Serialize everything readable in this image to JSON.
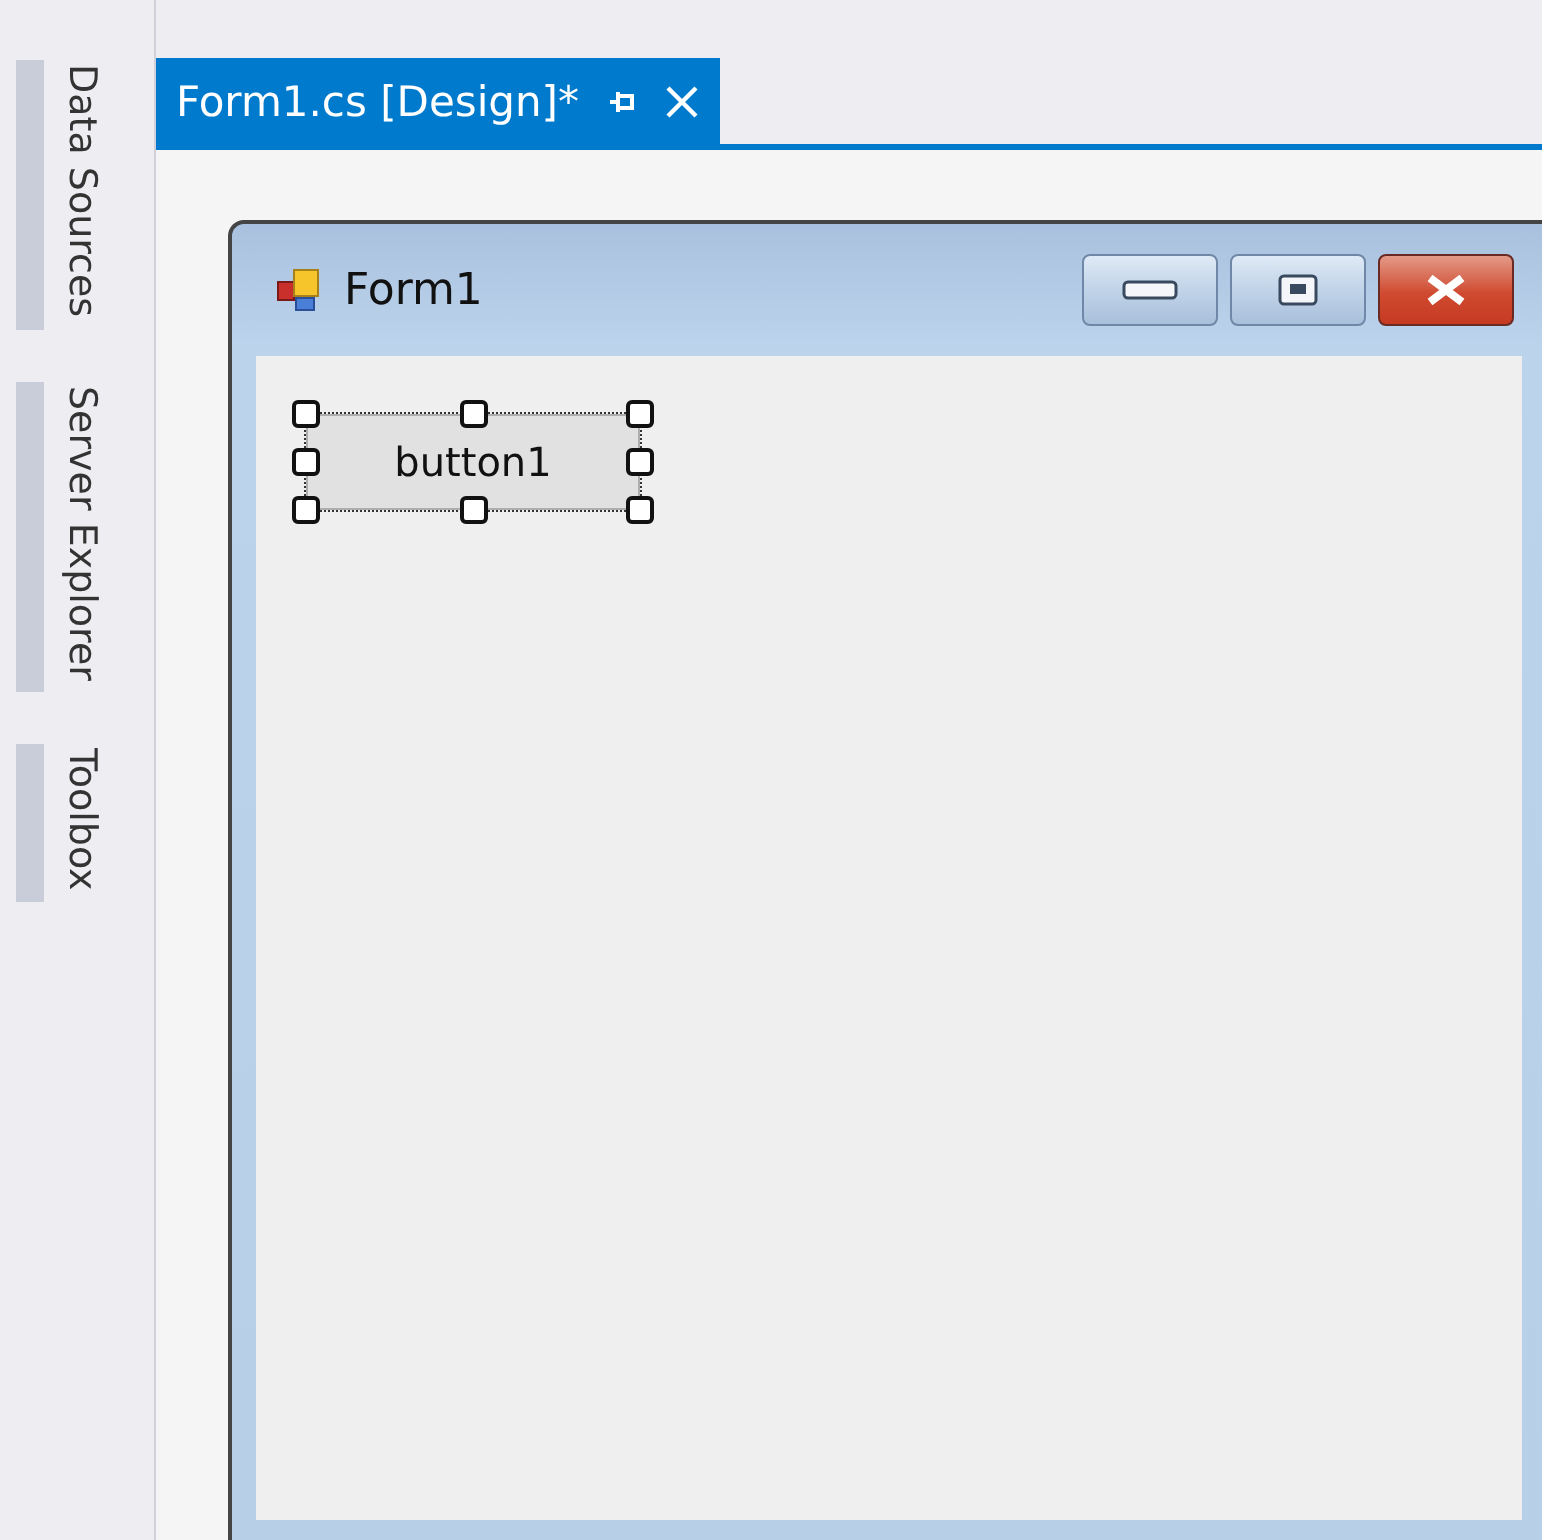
{
  "side_tabs": [
    {
      "label": "Data Sources"
    },
    {
      "label": "Server Explorer"
    },
    {
      "label": "Toolbox"
    }
  ],
  "document_tab": {
    "title": "Form1.cs [Design]*",
    "selected": true
  },
  "form": {
    "title": "Form1",
    "controls": [
      {
        "kind": "button",
        "text": "button1",
        "selected": true
      }
    ]
  }
}
